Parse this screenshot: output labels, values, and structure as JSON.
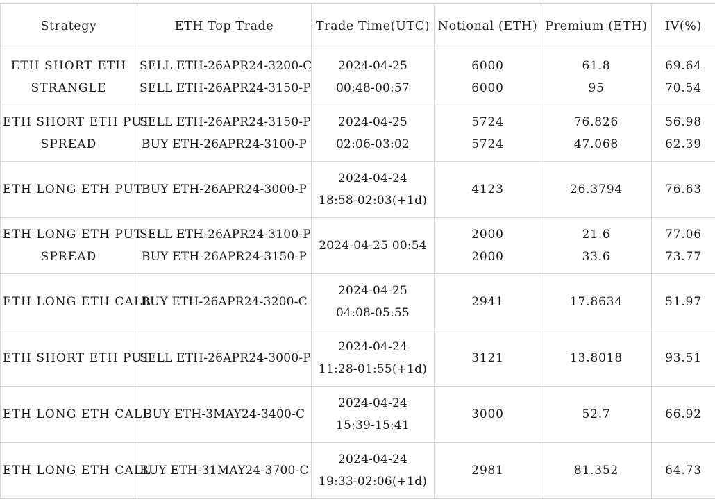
{
  "table": {
    "columns": [
      {
        "key": "strategy",
        "label": "Strategy"
      },
      {
        "key": "top_trade",
        "label": "ETH Top Trade"
      },
      {
        "key": "trade_time",
        "label": "Trade Time(UTC)"
      },
      {
        "key": "notional",
        "label": "Notional (ETH)"
      },
      {
        "key": "premium",
        "label": "Premium (ETH)"
      },
      {
        "key": "iv",
        "label": "IV(%)"
      }
    ],
    "rows": [
      {
        "strategy": [
          "ETH SHORT ETH",
          "STRANGLE"
        ],
        "top_trade": [
          "SELL ETH-26APR24-3200-C",
          "SELL ETH-26APR24-3150-P"
        ],
        "trade_time": [
          "2024-04-25",
          "00:48-00:57"
        ],
        "notional": [
          "6000",
          "6000"
        ],
        "premium": [
          "61.8",
          "95"
        ],
        "iv": [
          "69.64",
          "70.54"
        ]
      },
      {
        "strategy": [
          "ETH SHORT ETH PUT",
          "SPREAD"
        ],
        "top_trade": [
          "SELL ETH-26APR24-3150-P",
          "BUY ETH-26APR24-3100-P"
        ],
        "trade_time": [
          "2024-04-25",
          "02:06-03:02"
        ],
        "notional": [
          "5724",
          "5724"
        ],
        "premium": [
          "76.826",
          "47.068"
        ],
        "iv": [
          "56.98",
          "62.39"
        ]
      },
      {
        "strategy": [
          "ETH LONG ETH PUT"
        ],
        "top_trade": [
          "BUY ETH-26APR24-3000-P"
        ],
        "trade_time": [
          "2024-04-24",
          "18:58-02:03(+1d)"
        ],
        "notional": [
          "4123"
        ],
        "premium": [
          "26.3794"
        ],
        "iv": [
          "76.63"
        ]
      },
      {
        "strategy": [
          "ETH LONG ETH PUT",
          "SPREAD"
        ],
        "top_trade": [
          "SELL ETH-26APR24-3100-P",
          "BUY ETH-26APR24-3150-P"
        ],
        "trade_time": [
          "2024-04-25 00:54"
        ],
        "notional": [
          "2000",
          "2000"
        ],
        "premium": [
          "21.6",
          "33.6"
        ],
        "iv": [
          "77.06",
          "73.77"
        ]
      },
      {
        "strategy": [
          "ETH LONG ETH CALL"
        ],
        "top_trade": [
          "BUY ETH-26APR24-3200-C"
        ],
        "trade_time": [
          "2024-04-25",
          "04:08-05:55"
        ],
        "notional": [
          "2941"
        ],
        "premium": [
          "17.8634"
        ],
        "iv": [
          "51.97"
        ]
      },
      {
        "strategy": [
          "ETH SHORT ETH PUT"
        ],
        "top_trade": [
          "SELL ETH-26APR24-3000-P"
        ],
        "trade_time": [
          "2024-04-24",
          "11:28-01:55(+1d)"
        ],
        "notional": [
          "3121"
        ],
        "premium": [
          "13.8018"
        ],
        "iv": [
          "93.51"
        ]
      },
      {
        "strategy": [
          "ETH LONG ETH CALL"
        ],
        "top_trade": [
          "BUY ETH-3MAY24-3400-C"
        ],
        "trade_time": [
          "2024-04-24",
          "15:39-15:41"
        ],
        "notional": [
          "3000"
        ],
        "premium": [
          "52.7"
        ],
        "iv": [
          "66.92"
        ]
      },
      {
        "strategy": [
          "ETH LONG ETH CALL"
        ],
        "top_trade": [
          "BUY ETH-31MAY24-3700-C"
        ],
        "trade_time": [
          "2024-04-24",
          "19:33-02:06(+1d)"
        ],
        "notional": [
          "2981"
        ],
        "premium": [
          "81.352"
        ],
        "iv": [
          "64.73"
        ]
      }
    ]
  },
  "style": {
    "border_color": "#d6d6d6",
    "text_color": "#1a1a1a",
    "background": "#ffffff"
  }
}
